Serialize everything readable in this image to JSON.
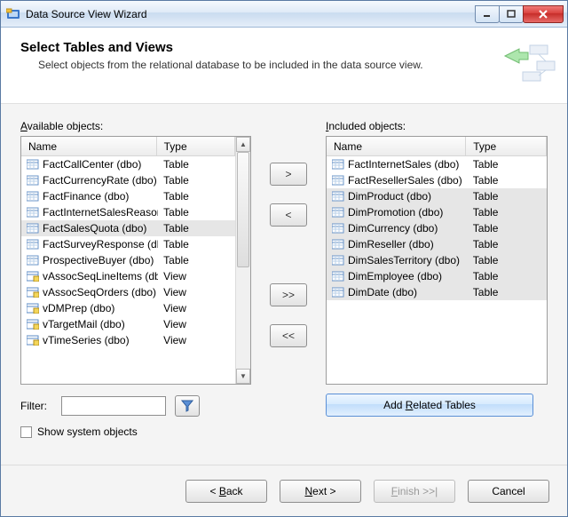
{
  "window": {
    "title": "Data Source View Wizard"
  },
  "header": {
    "title": "Select Tables and Views",
    "subtitle": "Select objects from the relational database to be included in the data source view."
  },
  "labels": {
    "available": "Available objects:",
    "available_ul": "A",
    "included": "Included objects:",
    "included_ul": "I",
    "name": "Name",
    "type": "Type",
    "filter": "Filter:",
    "show_system": "Show system objects",
    "add_related": "Add Related Tables",
    "add_related_ul": "R"
  },
  "move_buttons": {
    "add": ">",
    "remove": "<",
    "add_all": ">>",
    "remove_all": "<<"
  },
  "footer": {
    "back": "< Back",
    "back_ul": "B",
    "next": "Next >",
    "next_ul": "N",
    "finish": "Finish >>|",
    "finish_ul": "F",
    "cancel": "Cancel"
  },
  "available": [
    {
      "name": "FactCallCenter (dbo)",
      "type": "Table",
      "icon": "table"
    },
    {
      "name": "FactCurrencyRate (dbo)",
      "type": "Table",
      "icon": "table"
    },
    {
      "name": "FactFinance (dbo)",
      "type": "Table",
      "icon": "table"
    },
    {
      "name": "FactInternetSalesReason (...",
      "type": "Table",
      "icon": "table"
    },
    {
      "name": "FactSalesQuota (dbo)",
      "type": "Table",
      "icon": "table",
      "selected": true
    },
    {
      "name": "FactSurveyResponse (dbo)",
      "type": "Table",
      "icon": "table"
    },
    {
      "name": "ProspectiveBuyer (dbo)",
      "type": "Table",
      "icon": "table"
    },
    {
      "name": "vAssocSeqLineItems (dbo)",
      "type": "View",
      "icon": "view"
    },
    {
      "name": "vAssocSeqOrders (dbo)",
      "type": "View",
      "icon": "view"
    },
    {
      "name": "vDMPrep (dbo)",
      "type": "View",
      "icon": "view"
    },
    {
      "name": "vTargetMail (dbo)",
      "type": "View",
      "icon": "view"
    },
    {
      "name": "vTimeSeries (dbo)",
      "type": "View",
      "icon": "view"
    }
  ],
  "included": [
    {
      "name": "FactInternetSales (dbo)",
      "type": "Table",
      "icon": "table"
    },
    {
      "name": "FactResellerSales (dbo)",
      "type": "Table",
      "icon": "table"
    },
    {
      "name": "DimProduct (dbo)",
      "type": "Table",
      "icon": "table",
      "selected": true
    },
    {
      "name": "DimPromotion (dbo)",
      "type": "Table",
      "icon": "table",
      "selected": true
    },
    {
      "name": "DimCurrency (dbo)",
      "type": "Table",
      "icon": "table",
      "selected": true
    },
    {
      "name": "DimReseller (dbo)",
      "type": "Table",
      "icon": "table",
      "selected": true
    },
    {
      "name": "DimSalesTerritory (dbo)",
      "type": "Table",
      "icon": "table",
      "selected": true
    },
    {
      "name": "DimEmployee (dbo)",
      "type": "Table",
      "icon": "table",
      "selected": true
    },
    {
      "name": "DimDate (dbo)",
      "type": "Table",
      "icon": "table",
      "selected": true
    }
  ],
  "filter": {
    "value": ""
  },
  "show_system_checked": false
}
